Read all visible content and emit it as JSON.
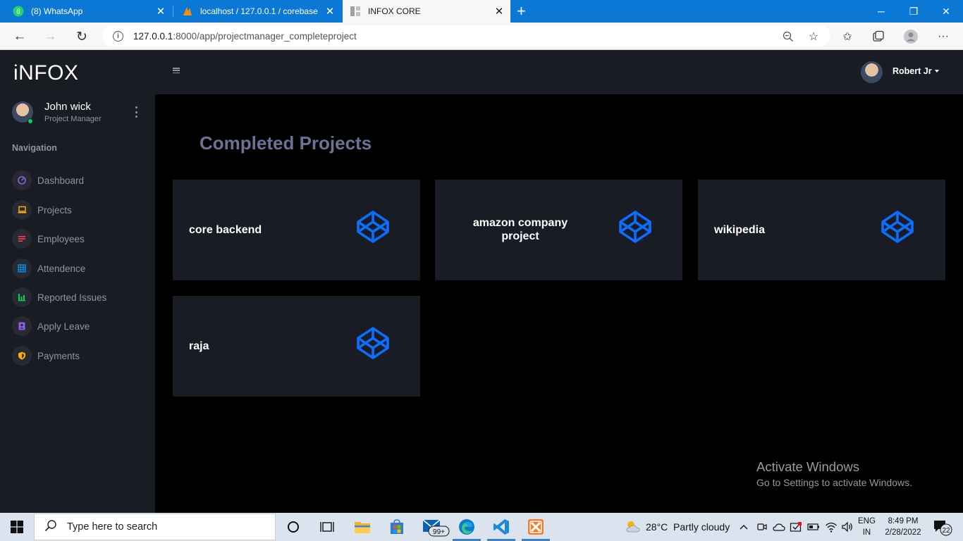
{
  "browser": {
    "tabs": [
      {
        "title": "(8) WhatsApp",
        "badge": "8",
        "active": false
      },
      {
        "title": "localhost / 127.0.0.1 / corebase",
        "active": false
      },
      {
        "title": "INFOX CORE",
        "active": true
      }
    ],
    "url_host": "127.0.0.1",
    "url_rest": ":8000/app/projectmanager_completeproject"
  },
  "sidebar": {
    "brand": "iNFOX",
    "profile": {
      "name": "John wick",
      "role": "Project Manager"
    },
    "nav_heading": "Navigation",
    "items": [
      {
        "label": "Dashboard",
        "icon": "speedometer-icon",
        "color": "#8f5fe8"
      },
      {
        "label": "Projects",
        "icon": "laptop-icon",
        "color": "#ffab00"
      },
      {
        "label": "Employees",
        "icon": "playlist-icon",
        "color": "#fc424a"
      },
      {
        "label": "Attendence",
        "icon": "table-icon",
        "color": "#0090e7"
      },
      {
        "label": "Reported Issues",
        "icon": "chart-bar-icon",
        "color": "#00d25b"
      },
      {
        "label": "Apply Leave",
        "icon": "contacts-icon",
        "color": "#8f5fe8"
      },
      {
        "label": "Payments",
        "icon": "shield-icon",
        "color": "#ffab00"
      }
    ]
  },
  "topbar": {
    "user_name": "Robert Jr"
  },
  "main": {
    "title": "Completed Projects",
    "projects": [
      {
        "name": "core backend"
      },
      {
        "name": "amazon company project"
      },
      {
        "name": "wikipedia"
      },
      {
        "name": "raja"
      }
    ],
    "project_icon": "codepen-icon",
    "accent": "#0d6efd"
  },
  "watermark": {
    "line1": "Activate Windows",
    "line2": "Go to Settings to activate Windows."
  },
  "taskbar": {
    "search_placeholder": "Type here to search",
    "mail_badge": "99+",
    "weather": "28°C  Partly cloudy",
    "lang1": "ENG",
    "lang2": "IN",
    "time": "8:49 PM",
    "date": "2/28/2022",
    "notifications": "22"
  }
}
